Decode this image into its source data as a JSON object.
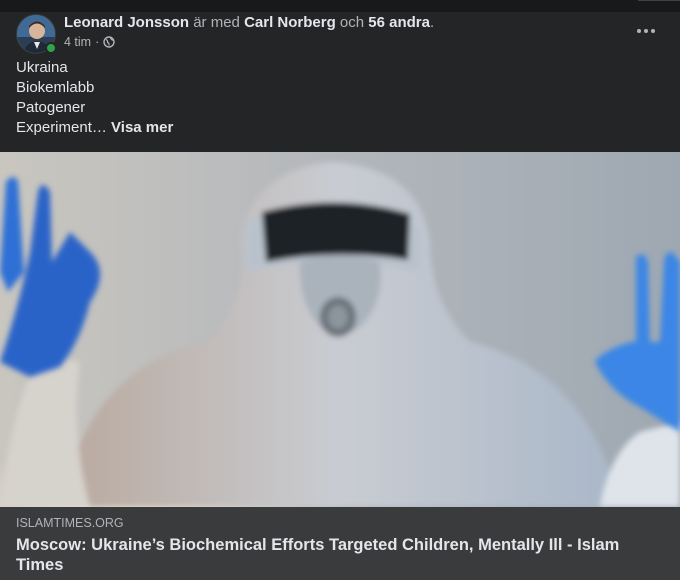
{
  "post": {
    "author": "Leonard Jonsson",
    "with_word": "är med",
    "tagged": "Carl Norberg",
    "and_word": "och",
    "others": "56 andra",
    "period": ".",
    "time": "4 tim",
    "separator": "·",
    "audience_icon": "globe-icon",
    "more_icon": "more-options-icon",
    "text_lines": [
      "Ukraina",
      "Biokemlabb",
      "Patogener"
    ],
    "last_line": "Experiment…",
    "see_more": "Visa mer"
  },
  "link": {
    "domain": "ISLAMTIMES.ORG",
    "headline": "Moscow: Ukraine’s Biochemical Efforts Targeted Children, Mentally Ill - Islam Times"
  },
  "colors": {
    "background": "#242526",
    "link_box": "#3a3b3c",
    "online": "#31a24c",
    "glove_blue": "#2a63c8"
  }
}
